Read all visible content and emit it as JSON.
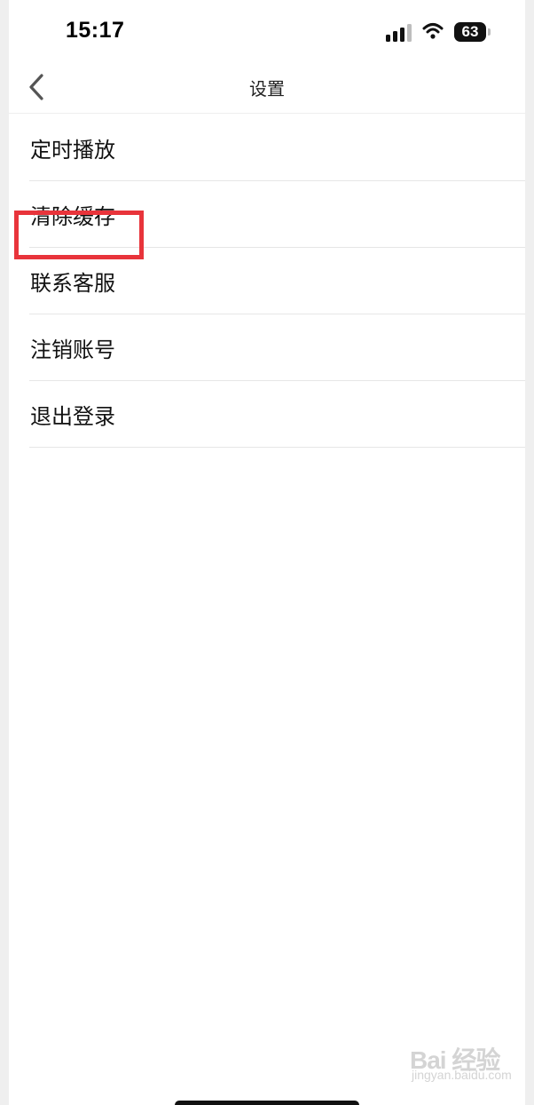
{
  "status_bar": {
    "time": "15:17",
    "battery": "63",
    "icons": [
      "signal-icon",
      "wifi-icon",
      "battery-icon"
    ]
  },
  "nav": {
    "title": "设置",
    "back_icon": "chevron-left-icon"
  },
  "settings": {
    "items": [
      {
        "label": "定时播放"
      },
      {
        "label": "清除缓存"
      },
      {
        "label": "联系客服"
      },
      {
        "label": "注销账号",
        "highlighted": true
      },
      {
        "label": "退出登录"
      }
    ]
  },
  "annotation": {
    "highlight_color": "#e8343b"
  },
  "watermark": {
    "main": "Bai 经验",
    "sub": "jingyan.baidu.com"
  }
}
